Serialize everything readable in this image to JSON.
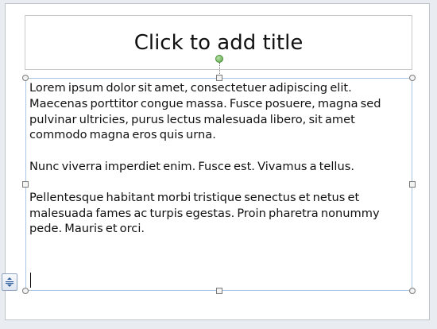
{
  "slide": {
    "title_placeholder": "Click to add title",
    "body_paragraphs": [
      "Lorem ipsum dolor sit amet, consectetuer adipiscing elit. Maecenas porttitor congue massa. Fusce posuere, magna sed pulvinar ultricies, purus lectus malesuada libero, sit amet commodo magna eros quis urna.",
      "Nunc viverra imperdiet enim. Fusce est. Vivamus a tellus.",
      "Pellentesque habitant morbi tristique senectus et netus et malesuada fames ac turpis egestas. Proin pharetra nonummy pede. Mauris et orci."
    ]
  },
  "icons": {
    "autofit": "autofit-options-icon",
    "rotate": "rotate-handle-icon"
  },
  "colors": {
    "selection_border": "#a9c4e4",
    "rotate_handle": "#5aa544",
    "slide_background": "#ffffff",
    "canvas_background": "#e9ecf1"
  }
}
